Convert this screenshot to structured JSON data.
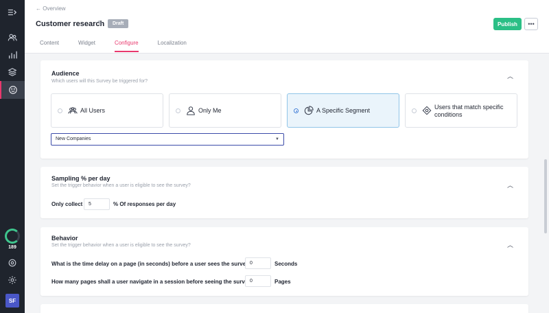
{
  "breadcrumb": {
    "back_label": "Overview"
  },
  "header": {
    "title": "Customer research",
    "status_badge": "Draft",
    "publish_label": "Publish",
    "more_label": "•••"
  },
  "tabs": [
    {
      "label": "Content"
    },
    {
      "label": "Widget"
    },
    {
      "label": "Configure"
    },
    {
      "label": "Localization"
    }
  ],
  "sidebar": {
    "count": "189",
    "avatar_initials": "SF"
  },
  "audience": {
    "title": "Audience",
    "subtitle": "Which users will this Survey be triggered for?",
    "options": [
      {
        "label": "All Users",
        "icon": "users-icon",
        "selected": false
      },
      {
        "label": "Only Me",
        "icon": "user-icon",
        "selected": false
      },
      {
        "label": "A Specific Segment",
        "icon": "pie-chart-icon",
        "selected": true
      },
      {
        "label": "Users that match specific conditions",
        "icon": "diamond-conditions-icon",
        "selected": false
      }
    ],
    "segment_value": "New Companies"
  },
  "sampling": {
    "title": "Sampling % per day",
    "subtitle": "Set the trigger behavior when a user is eligible to see the survey?",
    "prefix": "Only collect",
    "value": "5",
    "suffix": "% Of responses per day"
  },
  "behavior": {
    "title": "Behavior",
    "subtitle": "Set the trigger behavior when a user is eligible to see the survey?",
    "delay_question": "What is the time delay on a page (in seconds) before a user sees the survey?",
    "delay_value": "0",
    "delay_unit": "Seconds",
    "pages_question": "How many pages shall a user navigate in a session before seeing the survey?",
    "pages_value": "0",
    "pages_unit": "Pages"
  },
  "colors": {
    "accent": "#e8386d",
    "publish": "#2bbf86",
    "sidebar": "#1f242d"
  }
}
